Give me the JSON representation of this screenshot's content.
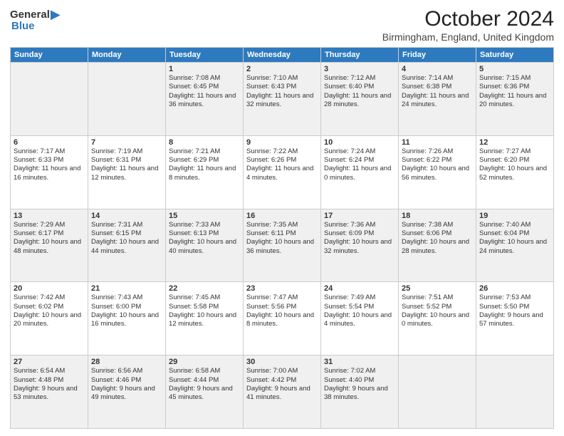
{
  "logo": {
    "general": "General",
    "blue": "Blue"
  },
  "title": "October 2024",
  "subtitle": "Birmingham, England, United Kingdom",
  "days": [
    "Sunday",
    "Monday",
    "Tuesday",
    "Wednesday",
    "Thursday",
    "Friday",
    "Saturday"
  ],
  "weeks": [
    [
      {
        "day": "",
        "content": ""
      },
      {
        "day": "",
        "content": ""
      },
      {
        "day": "1",
        "content": "Sunrise: 7:08 AM\nSunset: 6:45 PM\nDaylight: 11 hours and 36 minutes."
      },
      {
        "day": "2",
        "content": "Sunrise: 7:10 AM\nSunset: 6:43 PM\nDaylight: 11 hours and 32 minutes."
      },
      {
        "day": "3",
        "content": "Sunrise: 7:12 AM\nSunset: 6:40 PM\nDaylight: 11 hours and 28 minutes."
      },
      {
        "day": "4",
        "content": "Sunrise: 7:14 AM\nSunset: 6:38 PM\nDaylight: 11 hours and 24 minutes."
      },
      {
        "day": "5",
        "content": "Sunrise: 7:15 AM\nSunset: 6:36 PM\nDaylight: 11 hours and 20 minutes."
      }
    ],
    [
      {
        "day": "6",
        "content": "Sunrise: 7:17 AM\nSunset: 6:33 PM\nDaylight: 11 hours and 16 minutes."
      },
      {
        "day": "7",
        "content": "Sunrise: 7:19 AM\nSunset: 6:31 PM\nDaylight: 11 hours and 12 minutes."
      },
      {
        "day": "8",
        "content": "Sunrise: 7:21 AM\nSunset: 6:29 PM\nDaylight: 11 hours and 8 minutes."
      },
      {
        "day": "9",
        "content": "Sunrise: 7:22 AM\nSunset: 6:26 PM\nDaylight: 11 hours and 4 minutes."
      },
      {
        "day": "10",
        "content": "Sunrise: 7:24 AM\nSunset: 6:24 PM\nDaylight: 11 hours and 0 minutes."
      },
      {
        "day": "11",
        "content": "Sunrise: 7:26 AM\nSunset: 6:22 PM\nDaylight: 10 hours and 56 minutes."
      },
      {
        "day": "12",
        "content": "Sunrise: 7:27 AM\nSunset: 6:20 PM\nDaylight: 10 hours and 52 minutes."
      }
    ],
    [
      {
        "day": "13",
        "content": "Sunrise: 7:29 AM\nSunset: 6:17 PM\nDaylight: 10 hours and 48 minutes."
      },
      {
        "day": "14",
        "content": "Sunrise: 7:31 AM\nSunset: 6:15 PM\nDaylight: 10 hours and 44 minutes."
      },
      {
        "day": "15",
        "content": "Sunrise: 7:33 AM\nSunset: 6:13 PM\nDaylight: 10 hours and 40 minutes."
      },
      {
        "day": "16",
        "content": "Sunrise: 7:35 AM\nSunset: 6:11 PM\nDaylight: 10 hours and 36 minutes."
      },
      {
        "day": "17",
        "content": "Sunrise: 7:36 AM\nSunset: 6:09 PM\nDaylight: 10 hours and 32 minutes."
      },
      {
        "day": "18",
        "content": "Sunrise: 7:38 AM\nSunset: 6:06 PM\nDaylight: 10 hours and 28 minutes."
      },
      {
        "day": "19",
        "content": "Sunrise: 7:40 AM\nSunset: 6:04 PM\nDaylight: 10 hours and 24 minutes."
      }
    ],
    [
      {
        "day": "20",
        "content": "Sunrise: 7:42 AM\nSunset: 6:02 PM\nDaylight: 10 hours and 20 minutes."
      },
      {
        "day": "21",
        "content": "Sunrise: 7:43 AM\nSunset: 6:00 PM\nDaylight: 10 hours and 16 minutes."
      },
      {
        "day": "22",
        "content": "Sunrise: 7:45 AM\nSunset: 5:58 PM\nDaylight: 10 hours and 12 minutes."
      },
      {
        "day": "23",
        "content": "Sunrise: 7:47 AM\nSunset: 5:56 PM\nDaylight: 10 hours and 8 minutes."
      },
      {
        "day": "24",
        "content": "Sunrise: 7:49 AM\nSunset: 5:54 PM\nDaylight: 10 hours and 4 minutes."
      },
      {
        "day": "25",
        "content": "Sunrise: 7:51 AM\nSunset: 5:52 PM\nDaylight: 10 hours and 0 minutes."
      },
      {
        "day": "26",
        "content": "Sunrise: 7:53 AM\nSunset: 5:50 PM\nDaylight: 9 hours and 57 minutes."
      }
    ],
    [
      {
        "day": "27",
        "content": "Sunrise: 6:54 AM\nSunset: 4:48 PM\nDaylight: 9 hours and 53 minutes."
      },
      {
        "day": "28",
        "content": "Sunrise: 6:56 AM\nSunset: 4:46 PM\nDaylight: 9 hours and 49 minutes."
      },
      {
        "day": "29",
        "content": "Sunrise: 6:58 AM\nSunset: 4:44 PM\nDaylight: 9 hours and 45 minutes."
      },
      {
        "day": "30",
        "content": "Sunrise: 7:00 AM\nSunset: 4:42 PM\nDaylight: 9 hours and 41 minutes."
      },
      {
        "day": "31",
        "content": "Sunrise: 7:02 AM\nSunset: 4:40 PM\nDaylight: 9 hours and 38 minutes."
      },
      {
        "day": "",
        "content": ""
      },
      {
        "day": "",
        "content": ""
      }
    ]
  ]
}
